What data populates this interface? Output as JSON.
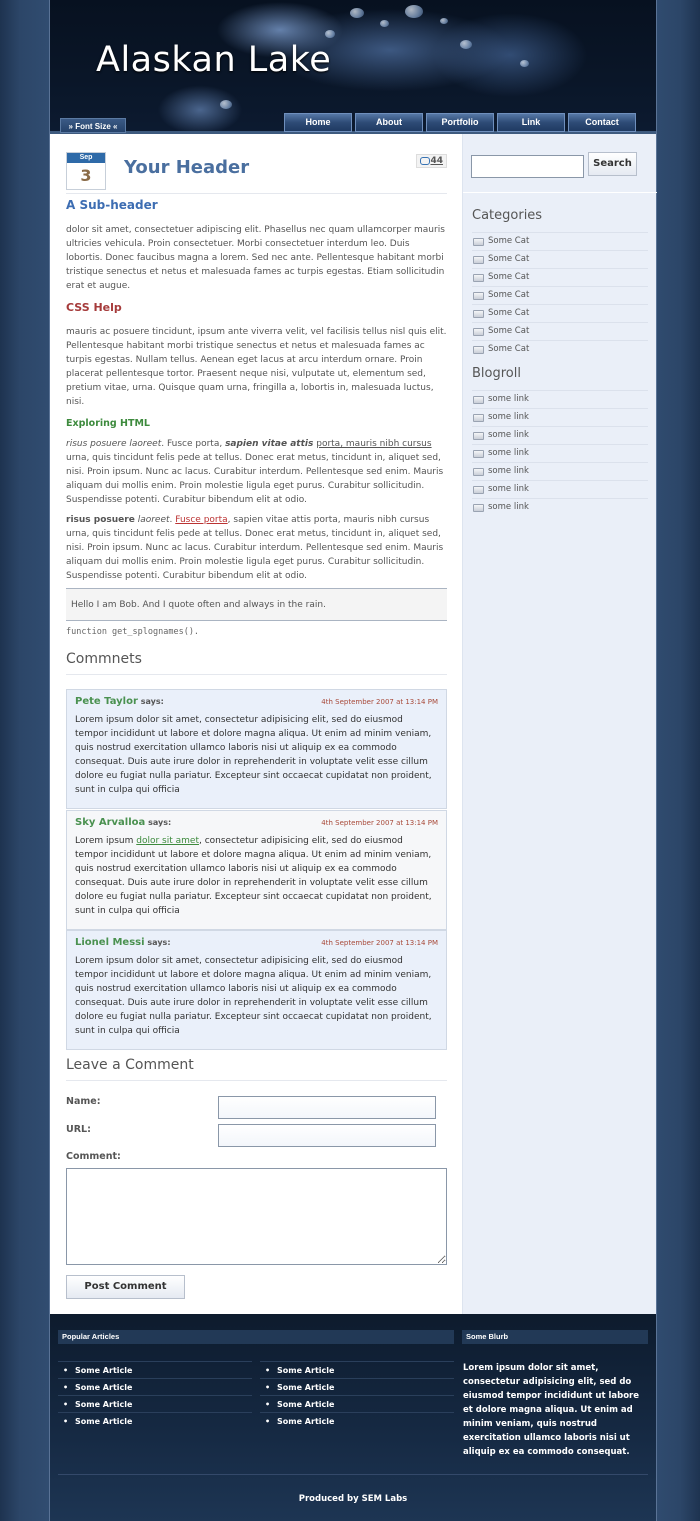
{
  "site": {
    "title": "Alaskan Lake",
    "font_size_label": "» Font Size «"
  },
  "nav": [
    "Home",
    "About",
    "Portfolio",
    "Link",
    "Contact"
  ],
  "post": {
    "month": "Sep",
    "day": "3",
    "title": "Your Header",
    "comment_count": "44",
    "subheader": "A Sub-header",
    "para1": "dolor sit amet, consectetuer adipiscing elit. Phasellus nec quam ullamcorper mauris ultricies vehicula. Proin consectetuer. Morbi consectetuer interdum leo. Duis lobortis. Donec faucibus magna a lorem. Sed nec ante. Pellentesque habitant morbi tristique senectus et netus et malesuada fames ac turpis egestas. Etiam sollicitudin erat et augue.",
    "h3": "CSS Help",
    "para2": "mauris ac posuere tincidunt, ipsum ante viverra velit, vel facilisis tellus nisl quis elit. Pellentesque habitant morbi tristique senectus et netus et malesuada fames ac turpis egestas. Nullam tellus. Aenean eget lacus at arcu interdum ornare. Proin placerat pellentesque tortor. Praesent neque nisi, vulputate ut, elementum sed, pretium vitae, urna. Quisque quam urna, fringilla a, lobortis in, malesuada luctus, nisi.",
    "h4": "Exploring HTML",
    "para3_em": "risus posuere laoreet",
    "para3_a": ". Fusce porta, ",
    "para3_strongem": "sapien vitae attis",
    "para3_b": " ",
    "para3_link": "porta, mauris nibh cursus",
    "para3_c": " urna, quis tincidunt felis pede at tellus. Donec erat metus, tincidunt in, aliquet sed, nisi. Proin ipsum. Nunc ac lacus. Curabitur interdum. Pellentesque sed enim. Mauris aliquam dui mollis enim. Proin molestie ligula eget purus. Curabitur sollicitudin. Suspendisse potenti. Curabitur bibendum elit at odio.",
    "para4_strong": "risus posuere",
    "para4_a": " ",
    "para4_em": "laoreet",
    "para4_b": ". ",
    "para4_link": "Fusce porta",
    "para4_c": ", sapien vitae attis porta, mauris nibh cursus urna, quis tincidunt felis pede at tellus. Donec erat metus, tincidunt in, aliquet sed, nisi. Proin ipsum. Nunc ac lacus. Curabitur interdum. Pellentesque sed enim. Mauris aliquam dui mollis enim. Proin molestie ligula eget purus. Curabitur sollicitudin. Suspendisse potenti. Curabitur bibendum elit at odio.",
    "quote": "Hello I am Bob. And I quote often and always in the rain.",
    "code": "function get_splognames()."
  },
  "comments_title": "Commnets",
  "comments": [
    {
      "author": "Pete Taylor",
      "says": "says:",
      "date": "4th September 2007 at 13:14 PM",
      "text_a": "Lorem ipsum dolor sit amet, consectetur adipisicing elit, sed do eiusmod tempor incididunt ut labore et dolore magna aliqua. Ut enim ad minim veniam, quis nostrud exercitation ullamco laboris nisi ut aliquip ex ea commodo consequat. Duis aute irure dolor in reprehenderit in voluptate velit esse cillum dolore eu fugiat nulla pariatur. Excepteur sint occaecat cupidatat non proident, sunt in culpa qui officia",
      "link": "",
      "text_b": ""
    },
    {
      "author": "Sky Arvalloa",
      "says": "says:",
      "date": "4th September 2007 at 13:14 PM",
      "text_a": "Lorem ipsum ",
      "link": "dolor sit amet",
      "text_b": ", consectetur adipisicing elit, sed do eiusmod tempor incididunt ut labore et dolore magna aliqua. Ut enim ad minim veniam, quis nostrud exercitation ullamco laboris nisi ut aliquip ex ea commodo consequat. Duis aute irure dolor in reprehenderit in voluptate velit esse cillum dolore eu fugiat nulla pariatur. Excepteur sint occaecat cupidatat non proident, sunt in culpa qui officia"
    },
    {
      "author": "Lionel Messi",
      "says": "says:",
      "date": "4th September 2007 at 13:14 PM",
      "text_a": "Lorem ipsum dolor sit amet, consectetur adipisicing elit, sed do eiusmod tempor incididunt ut labore et dolore magna aliqua. Ut enim ad minim veniam, quis nostrud exercitation ullamco laboris nisi ut aliquip ex ea commodo consequat. Duis aute irure dolor in reprehenderit in voluptate velit esse cillum dolore eu fugiat nulla pariatur. Excepteur sint occaecat cupidatat non proident, sunt in culpa qui officia",
      "link": "",
      "text_b": ""
    }
  ],
  "form": {
    "title": "Leave a Comment",
    "name_label": "Name:",
    "url_label": "URL:",
    "comment_label": "Comment:",
    "name_value": "",
    "url_value": "",
    "comment_value": "",
    "submit": "Post Comment"
  },
  "sidebar": {
    "search_value": "",
    "search_button": "Search",
    "categories_title": "Categories",
    "categories": [
      "Some Cat",
      "Some Cat",
      "Some Cat",
      "Some Cat",
      "Some Cat",
      "Some Cat",
      "Some Cat"
    ],
    "blogroll_title": "Blogroll",
    "blogroll": [
      "some link",
      "some link",
      "some link",
      "some link",
      "some link",
      "some link",
      "some link"
    ]
  },
  "footer": {
    "popular_title": "Popular Articles",
    "col1": [
      "Some Article",
      "Some Article",
      "Some Article",
      "Some Article"
    ],
    "col2": [
      "Some Article",
      "Some Article",
      "Some Article",
      "Some Article"
    ],
    "blurb_title": "Some Blurb",
    "blurb": "Lorem ipsum dolor sit amet, consectetur adipisicing elit, sed do eiusmod tempor incididunt ut labore et dolore magna aliqua. Ut enim ad minim veniam, quis nostrud exercitation ullamco laboris nisi ut aliquip ex ea commodo consequat.",
    "credit": "Produced by SEM Labs"
  }
}
